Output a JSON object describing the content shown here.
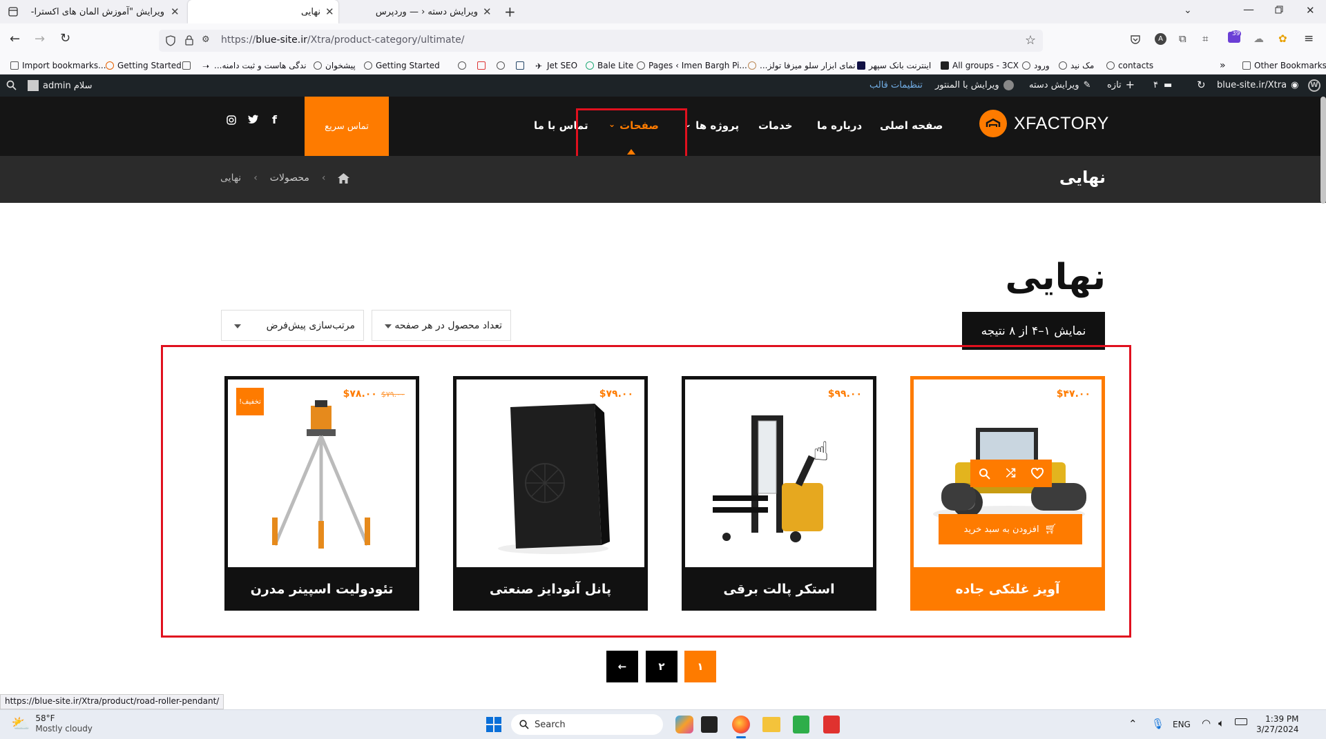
{
  "browser": {
    "tabs": [
      {
        "title": "ویرایش \"آموزش المان های اکسترا- ع"
      },
      {
        "title": "نهایی"
      },
      {
        "title": "ویرایش دسته ‹ — وردپرس"
      }
    ],
    "url_prefix": "https://",
    "url_domain": "blue-site.ir",
    "url_path": "/Xtra/product-category/ultimate/",
    "bookmarks": [
      "Import bookmarks...",
      "Getting Started",
      "...ندگی هاست و ثبت دامنه",
      "پیشخوان",
      "Getting Started",
      "Jet SEO",
      "Bale Lite",
      "Pages ‹ Imen Bargh Pi...",
      "...نمای ابزار سلو میزفا تولز",
      "اینترنت بانک سپهر",
      "All groups - 3CX",
      "ورود",
      "مک نید",
      "contacts"
    ],
    "other_bookmarks": "Other Bookmarks",
    "ext_badge": "39",
    "status_url": "https://blue-site.ir/Xtra/product/road-roller-pendant/"
  },
  "adminbar": {
    "greeting": "سلام admin",
    "theme_settings": "تنظیمات قالب",
    "elementor": "ویرایش با المنتور",
    "edit_category": "ویرایش دسته",
    "new": "تازه",
    "comments": "۴",
    "site": "blue-site.ir/Xtra"
  },
  "header": {
    "logo": "XFACTORY",
    "menu": {
      "home": "صفحه اصلی",
      "about": "درباره ما",
      "services": "خدمات",
      "projects": "پروژه ها",
      "pages": "صفحات",
      "contact": "تماس با ما"
    },
    "quick_call": "تماس سریع"
  },
  "titlebar": {
    "title": "نهایی",
    "crumb_products": "محصولات",
    "crumb_current": "نهایی"
  },
  "main": {
    "heading": "نهایی",
    "result_count": "نمایش ۱–۴ از ۸ نتیجه",
    "per_page": "تعداد محصول در هر صفحه",
    "sort": "مرتب‌سازی پیش‌فرض"
  },
  "products": [
    {
      "name": "آویز غلتکی جاده",
      "price": "$۴۷.۰۰",
      "add_to_cart": "افزودن به سبد خرید"
    },
    {
      "name": "استکر پالت برقی",
      "price": "$۹۹.۰۰"
    },
    {
      "name": "پانل آنودایز صنعتی",
      "price": "$۷۹.۰۰"
    },
    {
      "name": "تئودولیت اسپینر مدرن",
      "price": "$۷۸.۰۰",
      "old_price": "$۷۹.۰۰",
      "badge": "تخفیف!"
    }
  ],
  "pagination": {
    "current": "۱",
    "next_page": "۲",
    "prev_arrow": "←"
  },
  "taskbar": {
    "temperature": "58°F",
    "weather": "Mostly cloudy",
    "search": "Search",
    "lang": "ENG",
    "time": "1:39 PM",
    "date": "3/27/2024"
  },
  "colors": {
    "accent": "#fe7b00",
    "dark": "#151515",
    "annotation_red": "#e0101e"
  }
}
